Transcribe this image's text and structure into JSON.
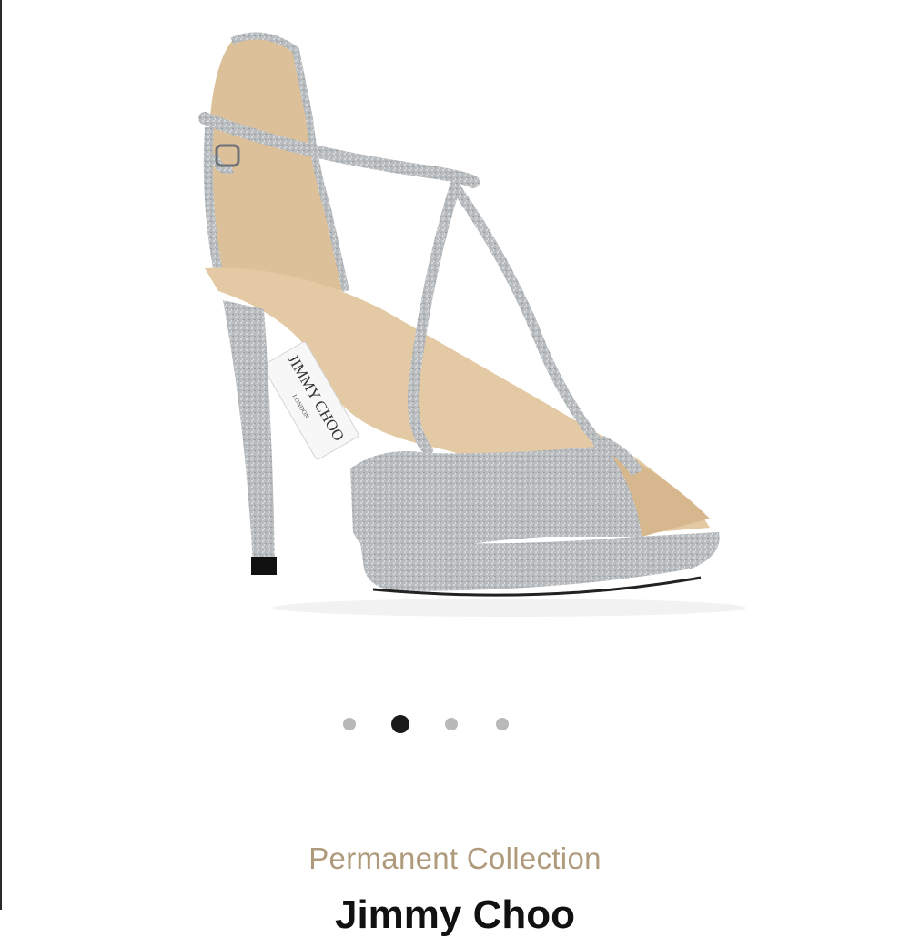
{
  "product": {
    "image_alt": "Silver glitter peep-toe platform sandal with ankle strap",
    "insole_logo": {
      "brand": "JIMMY CHOO",
      "city": "LONDON"
    }
  },
  "carousel": {
    "total": 4,
    "active_index": 1
  },
  "details": {
    "collection_label": "Permanent Collection",
    "brand_name": "Jimmy Choo"
  },
  "colors": {
    "collection_text": "#b09a7c",
    "dot_inactive": "#b9b9b9",
    "dot_active": "#1a1a1a"
  }
}
